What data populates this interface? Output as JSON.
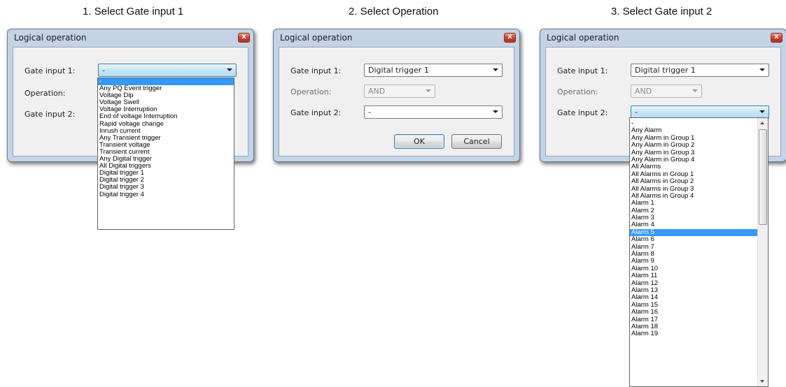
{
  "captions": [
    "1. Select Gate input 1",
    "2. Select Operation",
    "3. Select Gate input 2"
  ],
  "dialogs": [
    {
      "title": "Logical operation",
      "gate1_label": "Gate input 1:",
      "gate1_value": "-",
      "operation_label": "Operation:",
      "gate2_label": "Gate input 2:"
    },
    {
      "title": "Logical operation",
      "gate1_label": "Gate input 1:",
      "gate1_value": "Digital trigger 1",
      "operation_label": "Operation:",
      "operation_value": "AND",
      "gate2_label": "Gate input 2:",
      "gate2_value": "-",
      "ok_label": "OK",
      "cancel_label": "Cancel"
    },
    {
      "title": "Logical operation",
      "gate1_label": "Gate input 1:",
      "gate1_value": "Digital trigger 1",
      "operation_label": "Operation:",
      "operation_value": "AND",
      "gate2_label": "Gate input 2:",
      "gate2_value": "-"
    }
  ],
  "close_glyph": "x",
  "dropdown1": {
    "selected_index": 0,
    "items": [
      "-",
      "Any PQ Event trigger",
      "Voltage Dip",
      "Voltage Swell",
      "Voltage Interruption",
      "End of voltage Interruption",
      "Rapid voltage change",
      "Inrush current",
      "Any Transient trigger",
      "Transient voltage",
      "Transient current",
      "Any Digital trigger",
      "All Digital triggers",
      "Digital trigger 1",
      "Digital trigger 2",
      "Digital trigger 3",
      "Digital trigger 4"
    ]
  },
  "dropdown3": {
    "selected_index": 15,
    "items": [
      "-",
      "Any Alarm",
      "Any Alarm in Group 1",
      "Any Alarm in Group 2",
      "Any Alarm in Group 3",
      "Any Alarm in Group 4",
      "All Alarms",
      "All Alarms in Group 1",
      "All Alarms in Group 2",
      "All Alarms in Group 3",
      "All Alarms in Group 4",
      "Alarm 1",
      "Alarm 2",
      "Alarm 3",
      "Alarm 4",
      "Alarm 5",
      "Alarm 6",
      "Alarm 7",
      "Alarm 8",
      "Alarm 9",
      "Alarm 10",
      "Alarm 11",
      "Alarm 12",
      "Alarm 13",
      "Alarm 14",
      "Alarm 15",
      "Alarm 16",
      "Alarm 17",
      "Alarm 18",
      "Alarm 19"
    ]
  },
  "colors": {
    "selection": "#3399ff",
    "frame": "#c4d3e6",
    "close_button": "#c7432e"
  }
}
